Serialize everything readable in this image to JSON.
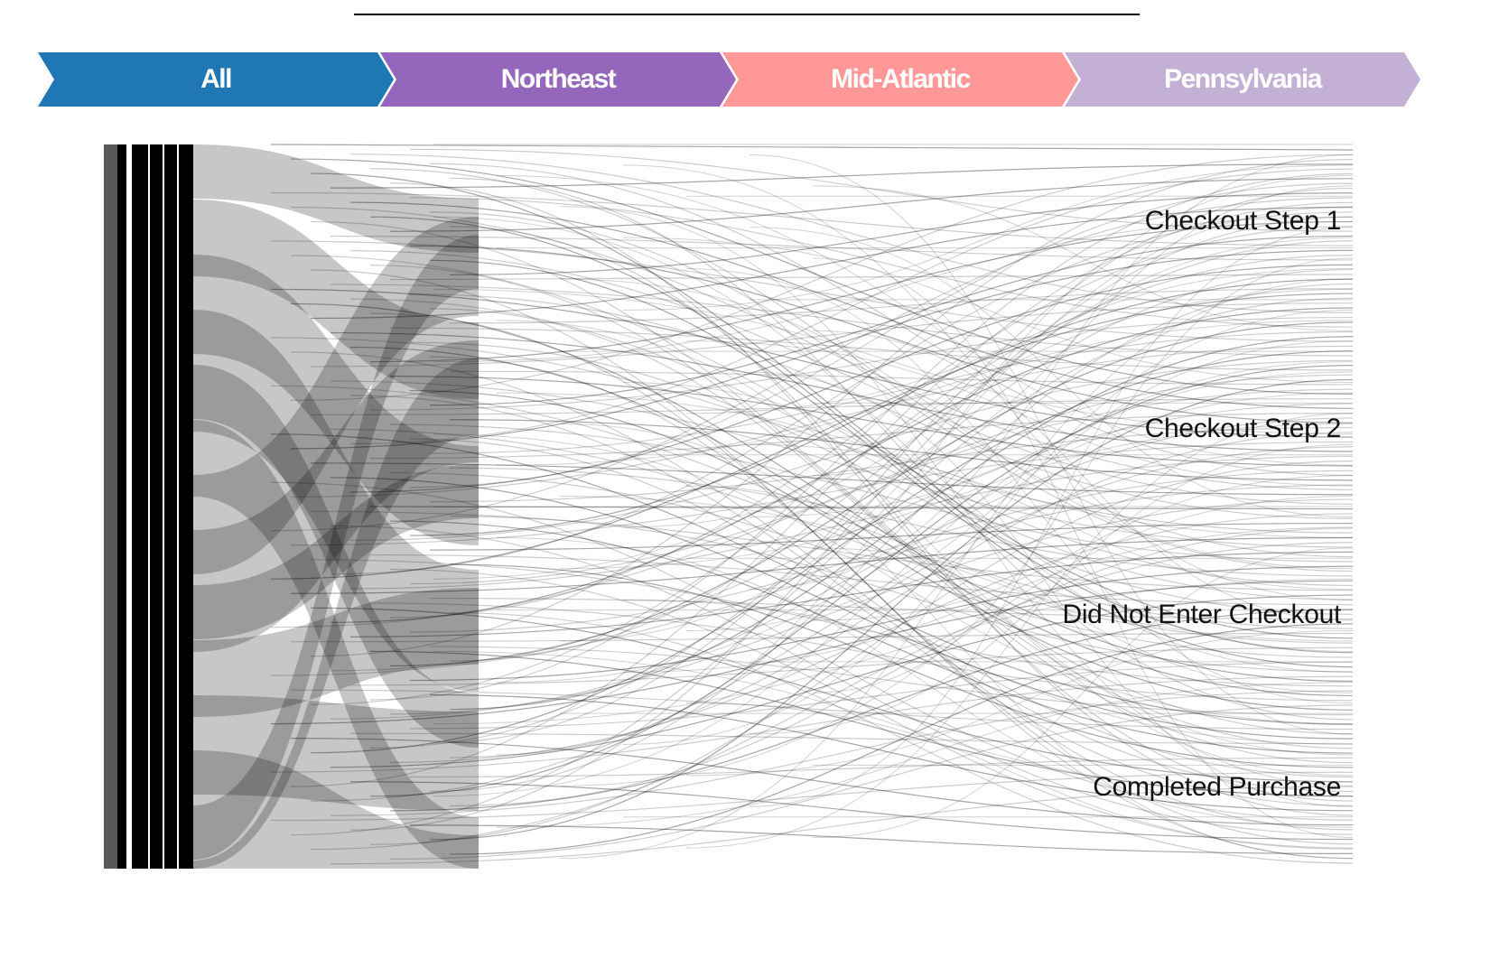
{
  "breadcrumb": {
    "items": [
      {
        "label": "All",
        "color": "#1f77b4"
      },
      {
        "label": "Northeast",
        "color": "#9467bd"
      },
      {
        "label": "Mid-Atlantic",
        "color": "#ff9896"
      },
      {
        "label": "Pennsylvania",
        "color": "#c5b0d5"
      }
    ]
  },
  "sankey": {
    "link_color": "#000000",
    "stages": [
      "Checkout Step 1",
      "Checkout Step 2",
      "Did Not Enter Checkout",
      "Completed Purchase"
    ]
  }
}
